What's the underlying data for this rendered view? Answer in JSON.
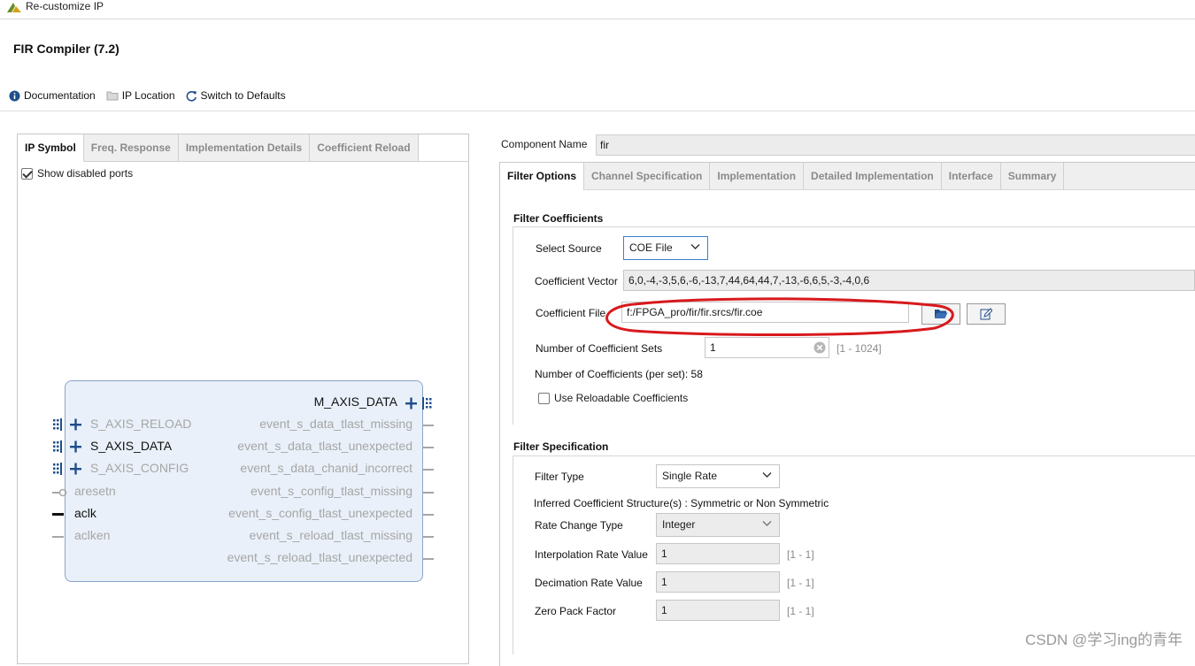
{
  "window": {
    "title": "Re-customize IP"
  },
  "product": {
    "title": "FIR Compiler (7.2)"
  },
  "toolbar": {
    "documentation": "Documentation",
    "ip_location": "IP Location",
    "switch_defaults": "Switch to Defaults"
  },
  "left_tabs": [
    "IP Symbol",
    "Freq. Response",
    "Implementation Details",
    "Coefficient Reload"
  ],
  "show_disabled_ports": "Show disabled ports",
  "symbol": {
    "master": "M_AXIS_DATA",
    "left_ports": [
      "S_AXIS_RELOAD",
      "S_AXIS_DATA",
      "S_AXIS_CONFIG",
      "aresetn",
      "aclk",
      "aclken"
    ],
    "right_ports": [
      "event_s_data_tlast_missing",
      "event_s_data_tlast_unexpected",
      "event_s_data_chanid_incorrect",
      "event_s_config_tlast_missing",
      "event_s_config_tlast_unexpected",
      "event_s_reload_tlast_missing",
      "event_s_reload_tlast_unexpected"
    ]
  },
  "component": {
    "label": "Component Name",
    "value": "fir"
  },
  "right_tabs": [
    "Filter Options",
    "Channel Specification",
    "Implementation",
    "Detailed Implementation",
    "Interface",
    "Summary"
  ],
  "filter_coefficients": {
    "title": "Filter Coefficients",
    "select_source_label": "Select Source",
    "select_source_value": "COE File",
    "coef_vector_label": "Coefficient Vector",
    "coef_vector_value": "6,0,-4,-3,5,6,-6,-13,7,44,64,44,7,-13,-6,6,5,-3,-4,0,6",
    "coef_file_label": "Coefficient File",
    "coef_file_value": "f:/FPGA_pro/fir/fir.srcs/fir.coe",
    "num_sets_label": "Number of Coefficient Sets",
    "num_sets_value": "1",
    "num_sets_range": "[1 - 1024]",
    "num_coefs_text": "Number of Coefficients (per set): 58",
    "reloadable_label": "Use Reloadable Coefficients"
  },
  "filter_spec": {
    "title": "Filter Specification",
    "filter_type_label": "Filter Type",
    "filter_type_value": "Single Rate",
    "inferred_text": "Inferred Coefficient Structure(s) : Symmetric or Non Symmetric",
    "rate_change_label": "Rate Change Type",
    "rate_change_value": "Integer",
    "interp_label": "Interpolation Rate Value",
    "interp_value": "1",
    "interp_range": "[1 - 1]",
    "decim_label": "Decimation Rate Value",
    "decim_value": "1",
    "decim_range": "[1 - 1]",
    "zero_pack_label": "Zero Pack Factor",
    "zero_pack_value": "1",
    "zero_pack_range": "[1 - 1]"
  },
  "watermark": "CSDN @学习ing的青年",
  "colors": {
    "annotation_red": "#d8191c",
    "block_fill": "#e9f0f9",
    "focus_blue": "#3c7fd1"
  }
}
